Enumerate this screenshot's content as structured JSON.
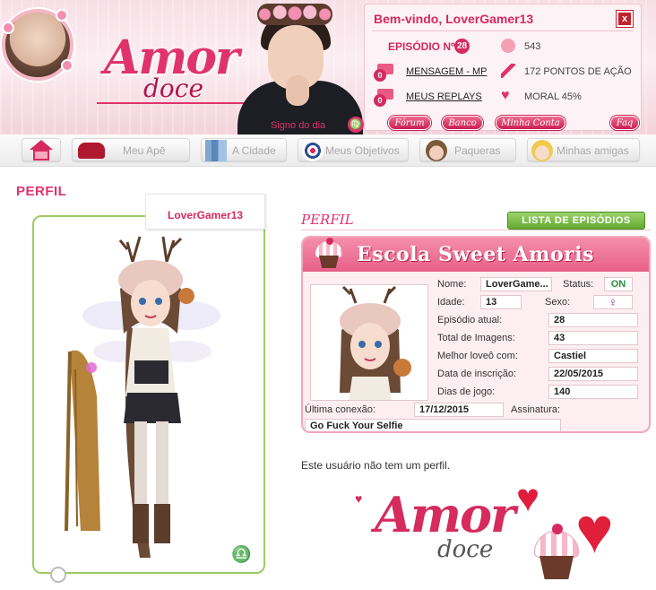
{
  "header": {
    "welcome": "Bem-vindo, LoverGamer13",
    "episode_label": "EPISÓDIO Nº",
    "episode_number": "28",
    "coins": "543",
    "messages_count": "0",
    "messages_label": "MENSAGEM - MP",
    "action_points": "172 PONTOS DE AÇÃO",
    "replays_count": "0",
    "replays_label": "MEUS REPLAYS",
    "moral": "MORAL 45%",
    "sign_label": "Signo do dia",
    "sign_glyph": "♍",
    "close_glyph": "x",
    "buttons": {
      "forum": "Fórum",
      "bank": "Banco",
      "account": "Minha Conta",
      "faq": "Faq"
    }
  },
  "logo": {
    "amor": "Amor",
    "doce": "doce"
  },
  "nav": {
    "items": [
      {
        "label": "",
        "icon": "home-icon"
      },
      {
        "label": "Meu Apê",
        "icon": "sofa-icon"
      },
      {
        "label": "A Cidade",
        "icon": "city-icon"
      },
      {
        "label": "Meus Objetivos",
        "icon": "target-icon"
      },
      {
        "label": "Paqueras",
        "icon": "boy-icon"
      },
      {
        "label": "Minhas amigas",
        "icon": "girl-icon"
      }
    ]
  },
  "profile": {
    "section_title": "PERFIL",
    "username": "LoverGamer13",
    "subtitle": "PERFIL",
    "episodes_button": "LISTA DE EPISÓDIOS",
    "school_title": "Escola Sweet Amoris",
    "zodiac_glyph": "♎",
    "fields": {
      "name_label": "Nome:",
      "name_value": "LoverGame...",
      "status_label": "Status:",
      "status_value": "ON",
      "age_label": "Idade:",
      "age_value": "13",
      "sex_label": "Sexo:",
      "sex_glyph": "♀",
      "episode_label": "Episódio atual:",
      "episode_value": "28",
      "images_label": "Total de Imagens:",
      "images_value": "43",
      "best_love_label": "Melhor loveô com:",
      "best_love_value": "Castiel",
      "signup_label": "Data de inscrição:",
      "signup_value": "22/05/2015",
      "days_label": "Dias de jogo:",
      "days_value": "140",
      "last_login_label": "Última conexão:",
      "last_login_value": "17/12/2015",
      "signature_label": "Assinatura:",
      "signature_value": "Go Fuck Your Selfie"
    },
    "no_profile_text": "Este usuário não tem um perfil."
  },
  "bottom_logo": {
    "amor": "Amor",
    "doce": "doce"
  },
  "colors": {
    "brand_pink": "#e0336b",
    "dark_pink": "#d42a5f",
    "green_button": "#63a832",
    "card_border_green": "#9ccc65"
  }
}
